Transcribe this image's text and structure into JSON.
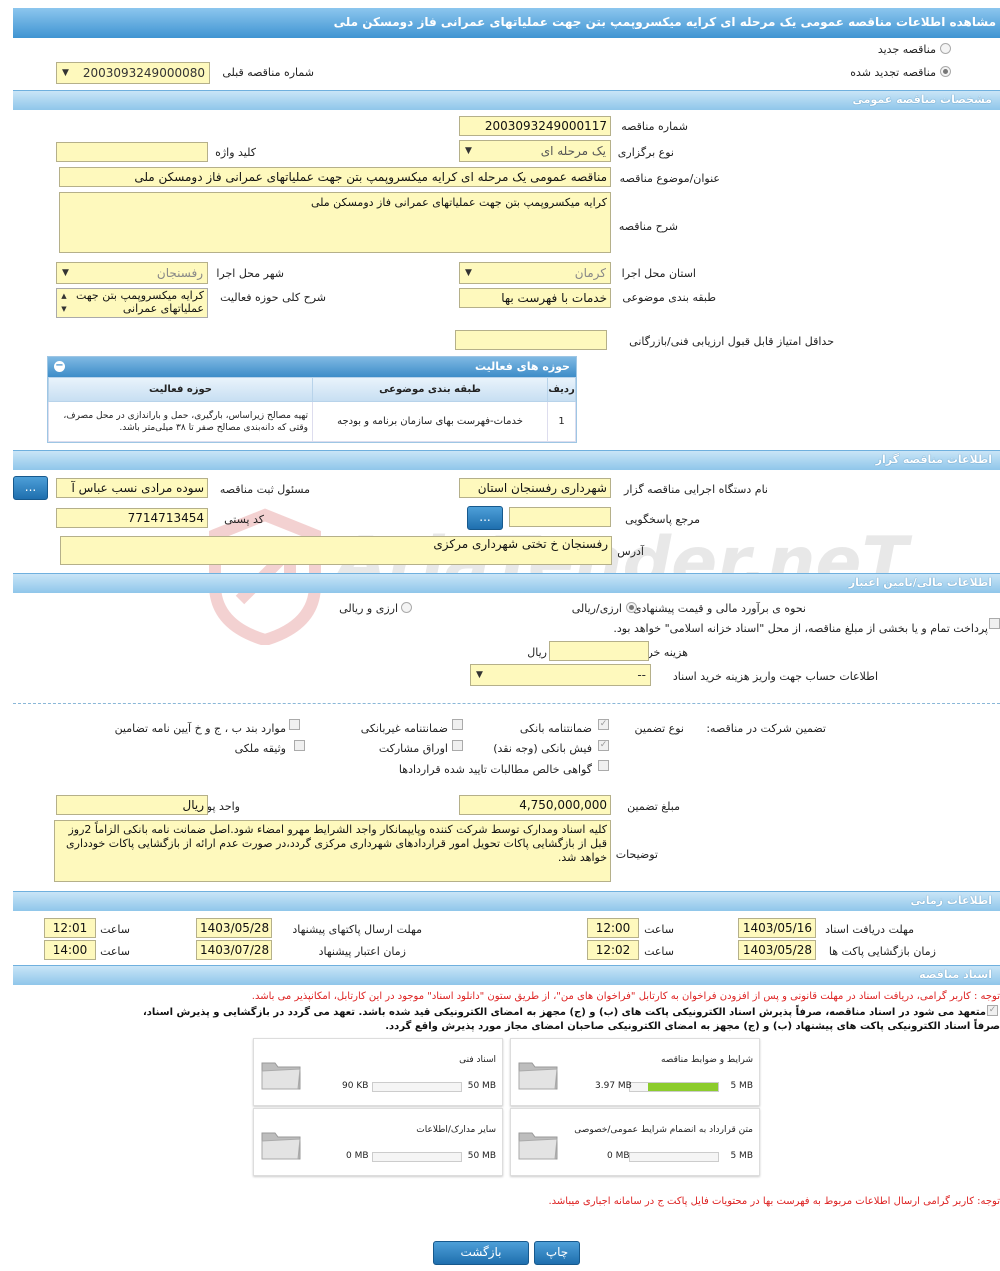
{
  "window_title": "مشاهده اطلاعات مناقصه عمومی یک مرحله ای کرایه میکسروپمپ بتن جهت عملیاتهای عمرانی فاز دومسکن ملی",
  "top": {
    "new_tender": "مناقصه جدید",
    "renewed_tender": "مناقصه تجدید شده",
    "prev_number_label": "شماره مناقصه قبلی",
    "prev_number_value": "2003093249000080"
  },
  "sections": {
    "general": "مشخصات مناقصه عمومی",
    "organizer": "اطلاعات مناقصه گزار",
    "financial": "اطلاعات مالی/تامین اعتبار",
    "timing": "اطلاعات زمانی",
    "documents": "اسناد مناقصه"
  },
  "general": {
    "number_label": "شماره مناقصه",
    "number_value": "2003093249000117",
    "type_label": "نوع برگزاری",
    "type_value": "یک مرحله ای",
    "keyword_label": "کلید واژه",
    "keyword_value": "",
    "title_label": "عنوان/موضوع مناقصه",
    "title_value": "مناقصه عمومی یک مرحله ای کرایه میکسروپمپ بتن جهت عملیاتهای عمرانی فاز دومسکن ملی",
    "desc_label": "شرح مناقصه",
    "desc_value": "کرایه میکسروپمپ بتن جهت عملیاتهای عمرانی فاز دومسکن ملی",
    "province_label": "استان محل اجرا",
    "province_value": "کرمان",
    "city_label": "شهر محل اجرا",
    "city_value": "رفسنجان",
    "category_label": "طبقه بندی موضوعی",
    "category_value": "خدمات با فهرست بها",
    "activity_desc_label": "شرح کلی حوزه فعالیت",
    "activity_desc_value": "کرایه میکسروپمپ بتن جهت عملیاتهای عمرانی",
    "min_score_label": "حداقل امتیاز قابل قبول ارزیابی فنی/بازرگانی",
    "min_score_value": ""
  },
  "activity_table": {
    "title": "حوزه های فعالیت",
    "headers": [
      "ردیف",
      "طبقه بندی موضوعی",
      "حوزه فعالیت"
    ],
    "rows": [
      {
        "row": "1",
        "category": "خدمات-فهرست بهای سازمان برنامه و بودجه",
        "field": "تهیه مصالح زیراساس، بارگیری، حمل و باراندازی در محل مصرف، وقتی که دانه‌بندی مصالح صفر تا ۳۸ میلی‌متر باشد."
      }
    ]
  },
  "organizer": {
    "org_label": "نام دستگاه اجرایی مناقصه گزار",
    "org_value": "شهرداری رفسنجان استان",
    "responsible_label": "مسئول ثبت مناقصه",
    "responsible_value": "سوده مرادی نسب عباس آ",
    "reference_label": "مرجع پاسخگویی",
    "reference_value": "",
    "postal_label": "کد پستی",
    "postal_value": "7714713454",
    "address_label": "آدرس",
    "address_value": "رفسنجان خ تختی شهرداری مرکزی",
    "dots": "..."
  },
  "financial": {
    "estimate_label": "نحوه ی برآورد مالی و قیمت پیشنهادی",
    "opt_rial": "ارزی/ریالی",
    "opt_currency": "ارزی و ریالی",
    "treasury_text": "پرداخت تمام و یا بخشی از مبلغ مناقصه، از محل \"اسناد خزانه اسلامی\" خواهد بود.",
    "doc_cost_label": "هزینه خرید اسناد",
    "doc_cost_value": "",
    "doc_cost_unit": "ریال",
    "account_label": "اطلاعات حساب جهت واریز هزینه خرید اسناد",
    "account_value": "--",
    "guarantee_label": "تضمین شرکت در مناقصه:",
    "guarantee_type_label": "نوع تضمین",
    "guarantee_opts": [
      "ضمانتنامه بانکی",
      "ضمانتنامه غیربانکی",
      "موارد بند ب ، ج و خ آیین نامه تضامین",
      "فیش بانکی (وجه نقد)",
      "اوراق مشارکت",
      "وثیقه ملکی",
      "گواهی خالص مطالبات تایید شده قراردادها"
    ],
    "amount_label": "مبلغ تضمین",
    "amount_value": "4,750,000,000",
    "currency_label": "واحد پول",
    "currency_value": "ریال",
    "notes_label": "توضیحات",
    "notes_value": "کلیه اسناد ومدارک توسط شرکت کننده وپایپمانکار واجد الشرایط مهرو امضاء شود.اصل ضمانت نامه بانکی  الزاماً 2روز قبل از بازگشایی پاکات تحویل امور قراردادهای شهرداری مرکزی گردد،در صورت عدم ارائه از بازگشایی پاکات خودداری خواهد شد."
  },
  "timing": {
    "receive_label": "مهلت دریافت اسناد",
    "receive_date": "1403/05/16",
    "receive_time": "12:00",
    "send_label": "مهلت ارسال پاکتهای پیشنهاد",
    "send_date": "1403/05/28",
    "send_time": "12:01",
    "open_label": "زمان بازگشایی پاکت ها",
    "open_date": "1403/05/28",
    "open_time": "12:02",
    "validity_label": "زمان اعتبار پیشنهاد",
    "validity_date": "1403/07/28",
    "validity_time": "14:00",
    "time_label": "ساعت"
  },
  "documents": {
    "note1": "توجه : کاربر گرامی، دریافت اسناد در مهلت قانونی و پس از افزودن فراخوان به کارتابل \"فراخوان های من\"، از طریق ستون \"دانلود اسناد\" موجود در این کارتابل، امکانپذیر می باشد.",
    "note2a": "متعهد می شود در اسناد مناقصه، صرفاً پذیرش اسناد الکترونیکی پاکت های (ب) و (ج) مجهز به امضای الکترونیکی قید شده باشد. تعهد می گردد در بازگشایی و پذیرش اسناد،",
    "note2b": "صرفاً اسناد الکترونیکی پاکت های پیشنهاد (ب) و (ج) مجهز به امضای الکترونیکی صاحبان امضای مجاز مورد پذیرش واقع گردد.",
    "files": [
      {
        "name": "شرایط و ضوابط مناقصه",
        "size": "5 MB",
        "used": "3.97 MB",
        "fraction": 0.79
      },
      {
        "name": "اسناد فنی",
        "size": "50 MB",
        "used": "90 KB",
        "fraction": 0.0
      },
      {
        "name": "متن قرارداد به انضمام شرایط عمومی/خصوصی",
        "size": "5 MB",
        "used": "0 MB",
        "fraction": 0.0
      },
      {
        "name": "سایر مدارک/اطلاعات",
        "size": "50 MB",
        "used": "0 MB",
        "fraction": 0.0
      }
    ],
    "note3": "توجه: کاربر گرامی ارسال اطلاعات مربوط به فهرست بها در محتویات فایل پاکت ج در سامانه اجباری میباشد."
  },
  "buttons": {
    "print": "چاپ",
    "back": "بازگشت"
  },
  "watermark": "AriaTender.neT"
}
